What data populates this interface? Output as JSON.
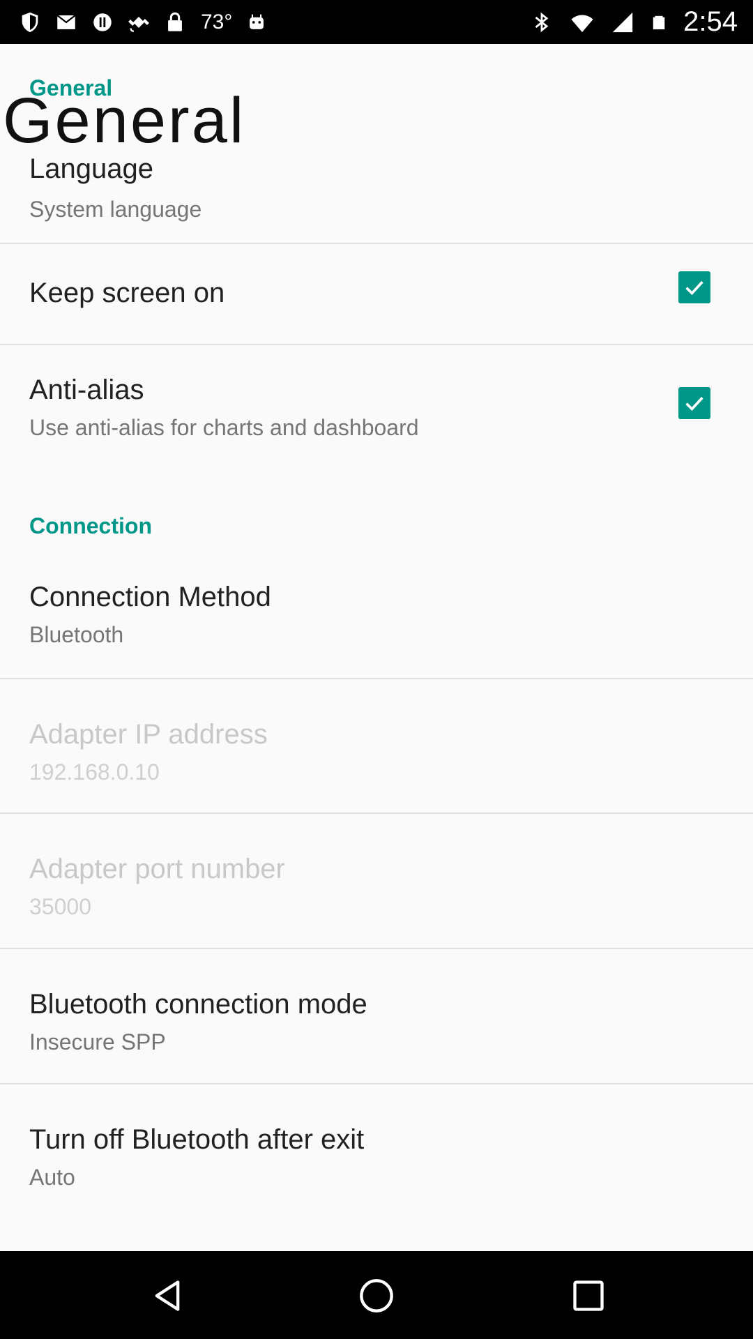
{
  "status_bar": {
    "temperature": "73°",
    "time": "2:54",
    "icons": [
      "shield-icon",
      "mail-icon",
      "sync-icon",
      "satellite-icon",
      "lock-icon",
      "android-icon",
      "bluetooth-icon",
      "wifi-icon",
      "signal-icon",
      "battery-icon"
    ]
  },
  "overlay_title": "General",
  "sections": {
    "general_header": "General",
    "connection_header": "Connection"
  },
  "prefs": {
    "language": {
      "title": "Language",
      "summary": "System language"
    },
    "keep_screen_on": {
      "title": "Keep screen on",
      "checked": true
    },
    "anti_alias": {
      "title": "Anti-alias",
      "summary": "Use anti-alias for charts and dashboard",
      "checked": true
    },
    "connection_method": {
      "title": "Connection Method",
      "summary": "Bluetooth"
    },
    "adapter_ip": {
      "title": "Adapter IP address",
      "summary": "192.168.0.10",
      "enabled": false
    },
    "adapter_port": {
      "title": "Adapter port number",
      "summary": "35000",
      "enabled": false
    },
    "bt_mode": {
      "title": "Bluetooth connection mode",
      "summary": "Insecure SPP"
    },
    "bt_off": {
      "title": "Turn off Bluetooth after exit",
      "summary": "Auto"
    }
  },
  "colors": {
    "accent": "#009688",
    "status_bar": "#000000",
    "background": "#fafafa"
  },
  "nav_bar": [
    "back-icon",
    "home-icon",
    "recents-icon"
  ]
}
